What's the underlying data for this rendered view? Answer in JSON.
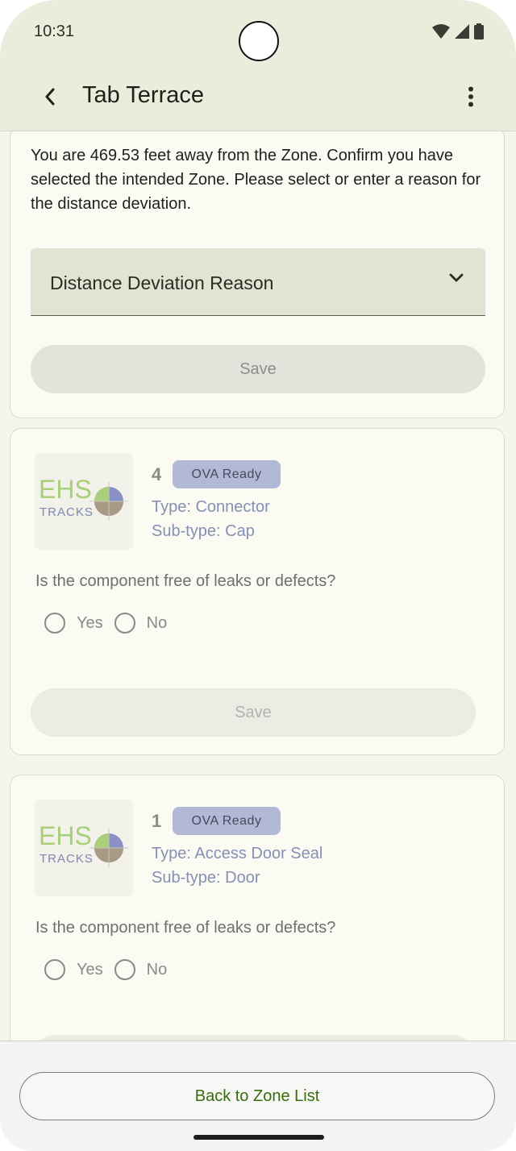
{
  "status_bar": {
    "time": "10:31"
  },
  "app_bar": {
    "title": "Tab Terrace"
  },
  "distance_card": {
    "message": "You are 469.53 feet away from the Zone. Confirm you have selected the intended Zone. Please select or enter a reason for the distance deviation.",
    "dropdown_label": "Distance Deviation Reason",
    "save_label": "Save"
  },
  "components": [
    {
      "logo_text_top": "EHS",
      "logo_text_bottom": "TRACKS",
      "number": "4",
      "badge": "OVA Ready",
      "type": "Type: Connector",
      "subtype": "Sub-type: Cap",
      "question": "Is the component free of leaks or defects?",
      "yes_label": "Yes",
      "no_label": "No",
      "save_label": "Save"
    },
    {
      "logo_text_top": "EHS",
      "logo_text_bottom": "TRACKS",
      "number": "1",
      "badge": "OVA Ready",
      "type": "Type: Access Door Seal",
      "subtype": "Sub-type: Door",
      "question": "Is the component free of leaks or defects?",
      "yes_label": "Yes",
      "no_label": "No"
    }
  ],
  "footer": {
    "back_label": "Back to Zone List"
  },
  "colors": {
    "accent_green": "#3a6b0e",
    "badge_bg": "#b2b9d6",
    "app_bar_bg": "#ebeddc"
  }
}
